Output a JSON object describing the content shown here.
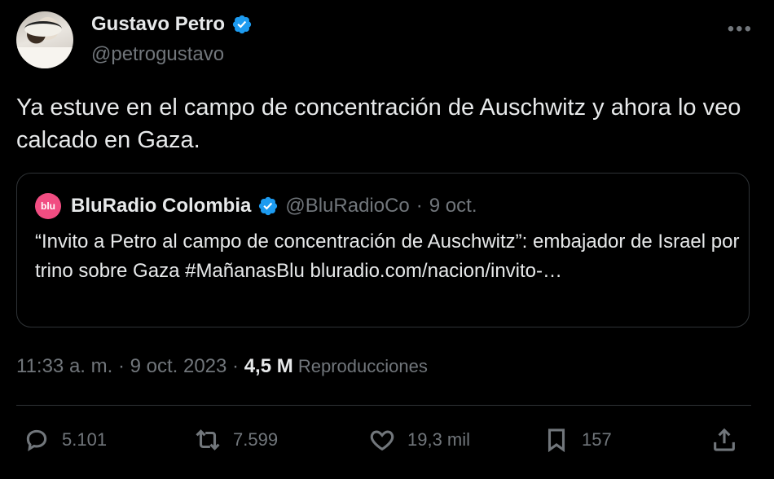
{
  "author": {
    "name": "Gustavo Petro",
    "handle": "@petrogustavo"
  },
  "more_label": "•••",
  "tweet_text": "Ya estuve en el campo de concentración de Auschwitz y ahora lo veo calcado en Gaza.",
  "quoted": {
    "avatar_text": "blu",
    "name": "BluRadio Colombia",
    "handle": "@BluRadioCo",
    "dot": "·",
    "date": "9 oct.",
    "text": "“Invito a Petro al campo de concentración de Auschwitz”: embajador de Israel por trino sobre Gaza #MañanasBlu bluradio.com/nacion/invito-…"
  },
  "meta": {
    "time": "11:33 a. m. · 9 oct. 2023 · ",
    "views_count": "4,5 M",
    "views_label": " Reproducciones"
  },
  "actions": {
    "replies": "5.101",
    "retweets": "7.599",
    "likes": "19,3 mil",
    "bookmarks": "157"
  },
  "colors": {
    "background": "#000000",
    "text": "#e7e9ea",
    "secondary": "#71767b",
    "verified": "#1d9bf0",
    "border": "#2f3336",
    "blu_brand": "#f14d82"
  },
  "icons": [
    "verified-badge-icon",
    "more-icon",
    "reply-icon",
    "retweet-icon",
    "like-icon",
    "bookmark-icon",
    "share-icon"
  ]
}
